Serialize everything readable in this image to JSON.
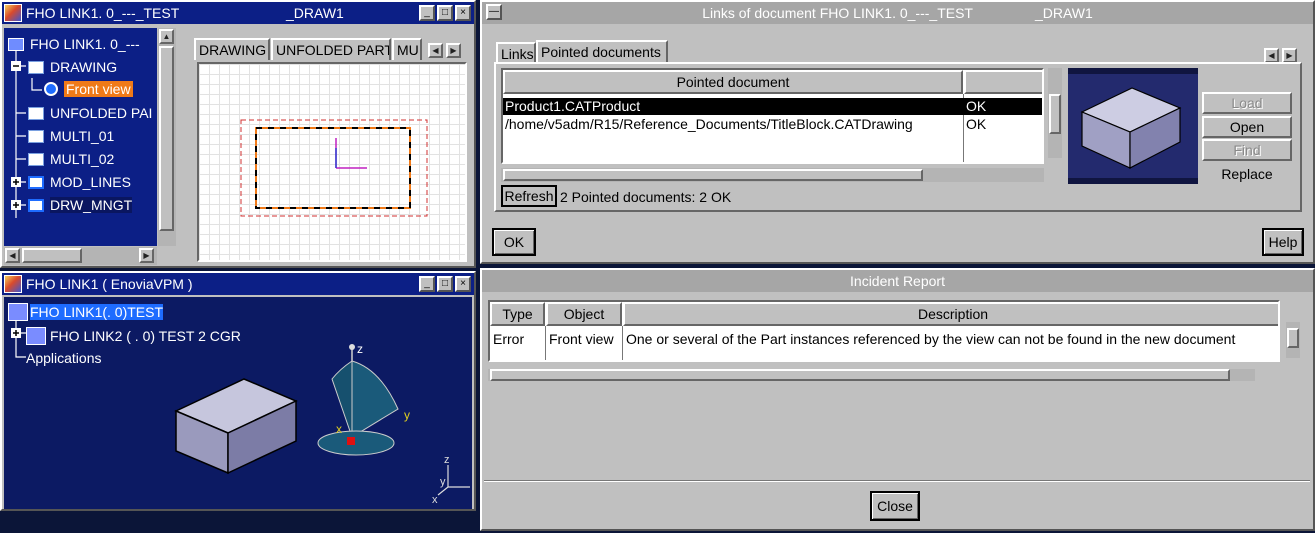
{
  "drawing_window": {
    "title_left": "FHO LINK1. 0_---_TEST",
    "title_right": "_DRAW1",
    "tree": [
      {
        "label": "FHO LINK1. 0_---"
      },
      {
        "label": "DRAWING"
      },
      {
        "label": "Front view"
      },
      {
        "label": "UNFOLDED PAI"
      },
      {
        "label": "MULTI_01"
      },
      {
        "label": "MULTI_02"
      },
      {
        "label": "MOD_LINES"
      },
      {
        "label": "DRW_MNGT"
      }
    ],
    "sheet_tabs": [
      "DRAWING",
      "UNFOLDED PART",
      "MUI"
    ]
  },
  "product_window": {
    "title": "FHO LINK1 ( EnoviaVPM )",
    "tree": [
      {
        "label": "FHO LINK1(. 0)TEST"
      },
      {
        "label": "FHO LINK2 ( . 0) TEST 2 CGR"
      },
      {
        "label": "Applications"
      }
    ],
    "compass": {
      "z": "z",
      "y": "y",
      "x": "x"
    },
    "axis_small": {
      "z": "z",
      "y": "y",
      "x": "x"
    }
  },
  "links_dialog": {
    "title": "Links of document FHO LINK1. 0_---_TEST                _DRAW1",
    "tabs": [
      "Links",
      "Pointed documents"
    ],
    "table_header": "Pointed document",
    "rows": [
      {
        "doc": "Product1.CATProduct",
        "status": "OK"
      },
      {
        "doc": "/home/v5adm/R15/Reference_Documents/TitleBlock.CATDrawing",
        "status": "OK"
      }
    ],
    "refresh_label": "Refresh",
    "summary": "2 Pointed documents: 2 OK",
    "buttons": {
      "load": "Load",
      "open": "Open",
      "find": "Find",
      "replace": "Replace"
    },
    "ok_label": "OK",
    "help_label": "Help"
  },
  "incident_dialog": {
    "title": "Incident Report",
    "columns": [
      "Type",
      "Object",
      "Description"
    ],
    "rows": [
      {
        "type": "Error",
        "object": "Front view",
        "description": "One or several of the Part instances referenced by the view can not be found in the new document"
      }
    ],
    "close_label": "Close"
  },
  "colors": {
    "title_active": "#0c1f86",
    "title_inactive": "#a6a6a6",
    "selection": "#1e6cff",
    "viewer_bg": "#0b1538",
    "highlight": "#f07a18"
  }
}
